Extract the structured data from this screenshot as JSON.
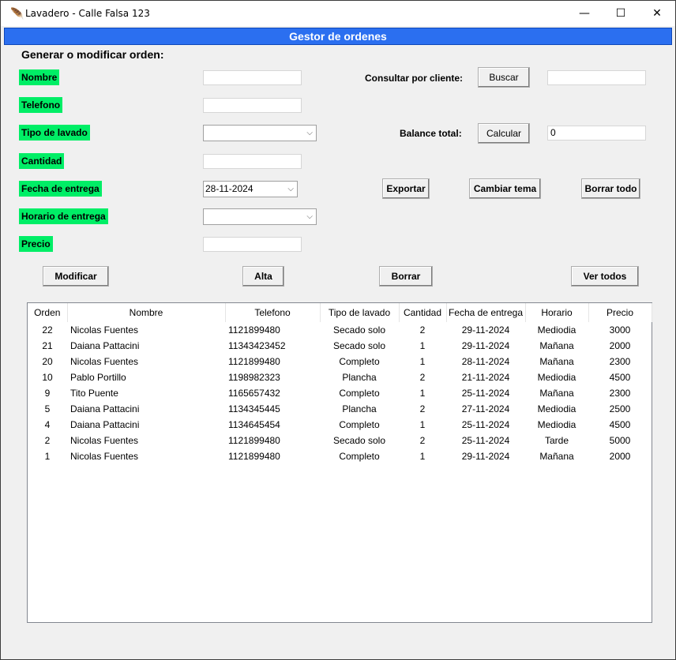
{
  "window": {
    "title": "Lavadero - Calle Falsa 123",
    "controls": {
      "minimize": "—",
      "maximize": "☐",
      "close": "✕"
    }
  },
  "banner": "Gestor de ordenes",
  "form": {
    "section_title": "Generar o modificar orden:",
    "labels": {
      "nombre": "Nombre",
      "telefono": "Telefono",
      "tipo_lavado": "Tipo de lavado",
      "cantidad": "Cantidad",
      "fecha_entrega": "Fecha de entrega",
      "horario_entrega": "Horario de entrega",
      "precio": "Precio"
    },
    "values": {
      "nombre": "",
      "telefono": "",
      "tipo_lavado": "",
      "cantidad": "",
      "fecha_entrega": "28-11-2024",
      "horario_entrega": "",
      "precio": ""
    },
    "buttons": {
      "modificar": "Modificar",
      "alta": "Alta",
      "borrar": "Borrar",
      "ver_todos": "Ver todos"
    }
  },
  "side": {
    "consultar_label": "Consultar por cliente:",
    "buscar_button": "Buscar",
    "buscar_value": "",
    "balance_label": "Balance total:",
    "calcular_button": "Calcular",
    "balance_value": "0",
    "exportar_button": "Exportar",
    "cambiar_tema_button": "Cambiar tema",
    "borrar_todo_button": "Borrar todo"
  },
  "table": {
    "headers": [
      "Orden",
      "Nombre",
      "Telefono",
      "Tipo de lavado",
      "Cantidad",
      "Fecha de entrega",
      "Horario",
      "Precio"
    ],
    "rows": [
      [
        "22",
        "Nicolas Fuentes",
        "1121899480",
        "Secado solo",
        "2",
        "29-11-2024",
        "Mediodia",
        "3000"
      ],
      [
        "21",
        "Daiana Pattacini",
        "11343423452",
        "Secado solo",
        "1",
        "29-11-2024",
        "Mañana",
        "2000"
      ],
      [
        "20",
        "Nicolas Fuentes",
        "1121899480",
        "Completo",
        "1",
        "28-11-2024",
        "Mañana",
        "2300"
      ],
      [
        "10",
        "Pablo Portillo",
        "1198982323",
        "Plancha",
        "2",
        "21-11-2024",
        "Mediodia",
        "4500"
      ],
      [
        "9",
        "Tito Puente",
        "1165657432",
        "Completo",
        "1",
        "25-11-2024",
        "Mañana",
        "2300"
      ],
      [
        "5",
        "Daiana Pattacini",
        "1134345445",
        "Plancha",
        "2",
        "27-11-2024",
        "Mediodia",
        "2500"
      ],
      [
        "4",
        "Daiana Pattacini",
        "1134645454",
        "Completo",
        "1",
        "25-11-2024",
        "Mediodia",
        "4500"
      ],
      [
        "2",
        "Nicolas Fuentes",
        "1121899480",
        "Secado solo",
        "2",
        "25-11-2024",
        "Tarde",
        "5000"
      ],
      [
        "1",
        "Nicolas Fuentes",
        "1121899480",
        "Completo",
        "1",
        "29-11-2024",
        "Mañana",
        "2000"
      ]
    ]
  },
  "colors": {
    "banner": "#2b6ff0",
    "label_bg": "#00ee66"
  },
  "icons": {
    "app": "feather-icon",
    "dropdown": "chevron-down-icon"
  }
}
